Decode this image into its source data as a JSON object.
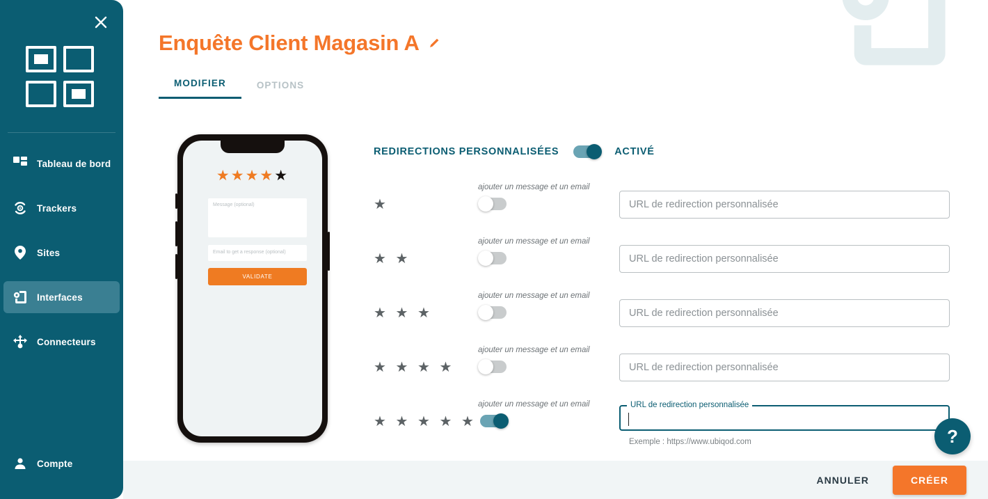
{
  "sidebar": {
    "close_icon": "close-icon",
    "logo_name": "ubiqod-logo",
    "items": [
      {
        "label": "Tableau de bord",
        "icon": "dashboard-icon",
        "active": false
      },
      {
        "label": "Trackers",
        "icon": "tracker-icon",
        "active": false
      },
      {
        "label": "Sites",
        "icon": "pin-icon",
        "active": false
      },
      {
        "label": "Interfaces",
        "icon": "interface-icon",
        "active": true
      },
      {
        "label": "Connecteurs",
        "icon": "connector-icon",
        "active": false
      }
    ],
    "account": {
      "label": "Compte",
      "icon": "person-icon"
    },
    "bg_color": "#0b5d72",
    "active_color": "#3a7f92"
  },
  "header": {
    "title": "Enquête Client Magasin A",
    "title_color": "#f4762a",
    "edit_icon": "pencil-icon",
    "tabs": [
      {
        "label": "MODIFIER",
        "active": true
      },
      {
        "label": "OPTIONS",
        "active": false
      }
    ]
  },
  "watermark": {
    "icon": "interface-icon",
    "color": "#e3edef"
  },
  "phone_preview": {
    "stars": [
      "on",
      "on",
      "on",
      "on",
      "selected"
    ],
    "message_placeholder": "Message (optional)",
    "email_placeholder": "Email to get a response (optional)",
    "validate_label": "VALIDATE",
    "star_on_color": "#ef7b22",
    "star_selected_color": "#15100e",
    "button_color": "#ef7b22"
  },
  "redirections": {
    "section_label": "REDIRECTIONS PERSONNALISÉES",
    "master_toggle": {
      "state": "on",
      "state_label": "ACTIVÉ"
    },
    "rows": [
      {
        "stars": "★",
        "message_label": "ajouter un message et un email",
        "toggle": "off",
        "input": {
          "placeholder": "URL de redirection personnalisée",
          "value": "",
          "focused": false
        }
      },
      {
        "stars": "★ ★",
        "message_label": "ajouter un message et un email",
        "toggle": "off",
        "input": {
          "placeholder": "URL de redirection personnalisée",
          "value": "",
          "focused": false
        }
      },
      {
        "stars": "★ ★ ★",
        "message_label": "ajouter un message et un email",
        "toggle": "off",
        "input": {
          "placeholder": "URL de redirection personnalisée",
          "value": "",
          "focused": false
        }
      },
      {
        "stars": "★ ★ ★ ★",
        "message_label": "ajouter un message et un email",
        "toggle": "off",
        "input": {
          "placeholder": "URL de redirection personnalisée",
          "value": "",
          "focused": false
        }
      },
      {
        "stars": "★ ★ ★ ★ ★",
        "message_label": "ajouter un message et un email",
        "toggle": "on",
        "input": {
          "label": "URL de redirection personnalisée",
          "placeholder": "",
          "value": "",
          "focused": true,
          "helper": "Exemple : https://www.ubiqod.com"
        }
      }
    ]
  },
  "help": {
    "label": "?",
    "icon": "question-mark-icon"
  },
  "bottom_bar": {
    "cancel_label": "ANNULER",
    "create_label": "CRÉER",
    "create_color": "#f4762a",
    "bg_color": "#f1f5f6"
  }
}
